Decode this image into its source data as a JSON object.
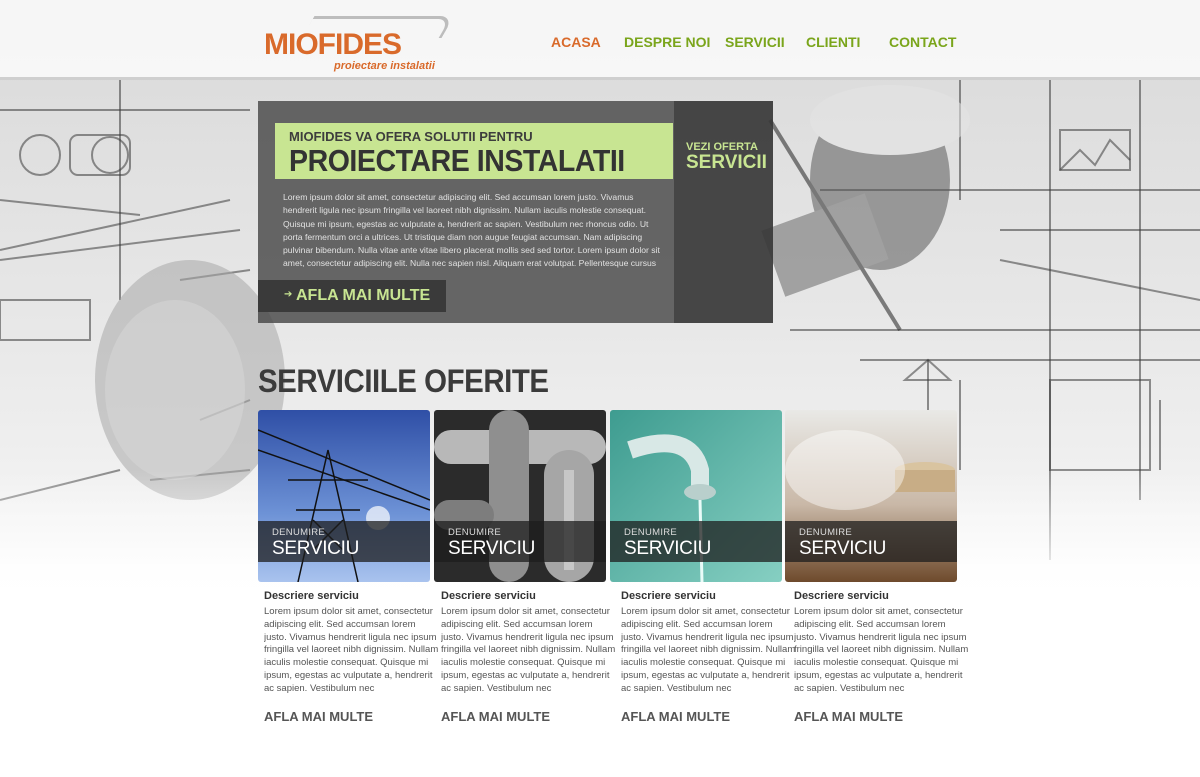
{
  "brand": {
    "name": "MIOFIDES",
    "tagline": "proiectare instalatii",
    "accent": "#d96a2b",
    "green": "#7aa51b",
    "lime": "#c8e592"
  },
  "nav": {
    "items": [
      {
        "label": "ACASA",
        "active": true
      },
      {
        "label": "DESPRE NOI",
        "active": false
      },
      {
        "label": "SERVICII",
        "active": false
      },
      {
        "label": "CLIENTI",
        "active": false
      },
      {
        "label": "CONTACT",
        "active": false
      }
    ]
  },
  "hero": {
    "subtitle": "MIOFIDES VA OFERA SOLUTII PENTRU",
    "title": "PROIECTARE INSTALATII",
    "offer_small": "VEZI OFERTA",
    "offer_big": "SERVICII",
    "text": "Lorem ipsum dolor sit amet, consectetur adipiscing elit. Sed accumsan lorem justo. Vivamus hendrerit ligula nec ipsum fringilla vel laoreet nibh dignissim. Nullam iaculis molestie consequat. Quisque mi ipsum, egestas ac vulputate a, hendrerit ac sapien. Vestibulum nec rhoncus odio. Ut porta fermentum orci a ultrices. Ut tristique diam non augue feugiat accumsan. Nam adipiscing pulvinar bibendum. Nulla vitae ante vitae libero placerat mollis sed sed tortor. Lorem ipsum dolor sit amet, consectetur adipiscing elit. Nulla nec sapien nisl. Aliquam erat volutpat. Pellentesque cursus volut-",
    "button": "AFLA MAI MULTE"
  },
  "services": {
    "title": "SERVICIILE OFERITE",
    "cards": [
      {
        "cap1": "DENUMIRE",
        "cap2": "SERVICIU",
        "heading": "Descriere serviciu",
        "text": "Lorem ipsum dolor sit amet, consectetur adipiscing elit. Sed accumsan lorem justo. Vivamus hendrerit ligula nec ipsum fringilla vel laoreet nibh dignissim. Nullam iaculis molestie consequat. Quisque mi ipsum, egestas ac vulputate a, hendrerit ac sapien. Vestibulum nec",
        "more": "AFLA MAI MULTE"
      },
      {
        "cap1": "DENUMIRE",
        "cap2": "SERVICIU",
        "heading": "Descriere serviciu",
        "text": "Lorem ipsum dolor sit amet, consectetur adipiscing elit. Sed accumsan lorem justo. Vivamus hendrerit ligula nec ipsum fringilla vel laoreet nibh dignissim. Nullam iaculis molestie consequat. Quisque mi ipsum, egestas ac vulputate a, hendrerit ac sapien. Vestibulum nec",
        "more": "AFLA MAI MULTE"
      },
      {
        "cap1": "DENUMIRE",
        "cap2": "SERVICIU",
        "heading": "Descriere serviciu",
        "text": "Lorem ipsum dolor sit amet, consectetur adipiscing elit. Sed accumsan lorem justo. Vivamus hendrerit ligula nec ipsum fringilla vel laoreet nibh dignissim. Nullam iaculis molestie consequat. Quisque mi ipsum, egestas ac vulputate a, hendrerit ac sapien. Vestibulum nec",
        "more": "AFLA MAI MULTE"
      },
      {
        "cap1": "DENUMIRE",
        "cap2": "SERVICIU",
        "heading": "Descriere serviciu",
        "text": "Lorem ipsum dolor sit amet, consectetur adipiscing elit. Sed accumsan lorem justo. Vivamus hendrerit ligula nec ipsum fringilla vel laoreet nibh dignissim. Nullam iaculis molestie consequat. Quisque mi ipsum, egestas ac vulputate a, hendrerit ac sapien. Vestibulum nec",
        "more": "AFLA MAI MULTE"
      }
    ]
  }
}
